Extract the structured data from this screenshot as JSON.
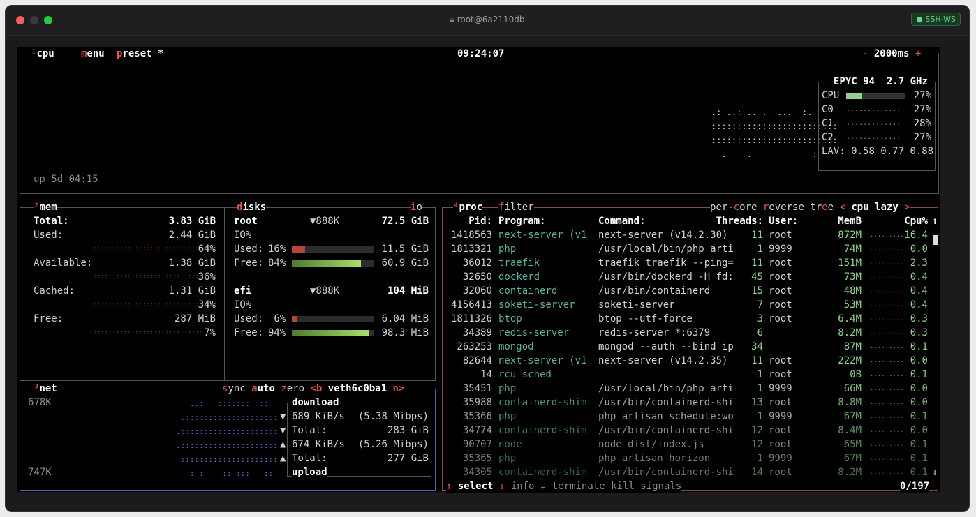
{
  "window": {
    "title": "root@6a2110db",
    "badge": "● SSH-WS"
  },
  "cpu": {
    "num": "¹",
    "label_cpu": "cpu",
    "label_menu": "menu",
    "label_preset": "preset *",
    "clock": "09:24:07",
    "interval": "2000ms",
    "minus": "-",
    "plus": "+",
    "uptime": "up 5d 04:15",
    "model": "EPYC 94",
    "freq": "2.7 GHz",
    "rows": [
      {
        "name": "CPU",
        "pct": "27%",
        "level": 0.27
      },
      {
        "name": "C0",
        "pct": "27%",
        "level": 0.27
      },
      {
        "name": "C1",
        "pct": "28%",
        "level": 0.28
      },
      {
        "name": "C2",
        "pct": "27%",
        "level": 0.27
      }
    ],
    "lav_label": "LAV:",
    "lav": "0.58 0.77 0.88"
  },
  "mem": {
    "num": "²",
    "title": "mem",
    "total_label": "Total:",
    "total": "3.83 GiB",
    "rows": [
      {
        "label": "Used:",
        "value": "2.44 GiB",
        "pct": "64%",
        "color": "#c0392b"
      },
      {
        "label": "Available:",
        "value": "1.38 GiB",
        "pct": "36%",
        "color": "#b8860b"
      },
      {
        "label": "Cached:",
        "value": "1.31 GiB",
        "pct": "34%",
        "color": "#4a6fb3"
      },
      {
        "label": "Free:",
        "value": "287 MiB",
        "pct": "7%",
        "color": "#7a5a2e"
      }
    ]
  },
  "disks": {
    "title_d": "d",
    "title_rest": "isks",
    "io_i": "i",
    "io_o": "o",
    "items": [
      {
        "name": "root",
        "io": "▼888K",
        "size": "72.5 GiB",
        "io_label": "IO%",
        "used_label": "Used:",
        "used_pct": "16%",
        "used": "11.5 GiB",
        "free_label": "Free:",
        "free_pct": "84%",
        "free": "60.9 GiB",
        "used_level": 0.16,
        "free_level": 0.84
      },
      {
        "name": "efi",
        "io": "▼888K",
        "size": "104 MiB",
        "io_label": "IO%",
        "used_label": "Used:",
        "used_pct": " 6%",
        "used": "6.04 MiB",
        "free_label": "Free:",
        "free_pct": "94%",
        "free": "98.3 MiB",
        "used_level": 0.06,
        "free_level": 0.94
      }
    ]
  },
  "net": {
    "num": "³",
    "title": "net",
    "sync": "sync",
    "auto": "auto",
    "zero": "zero",
    "iface_prev": "<b",
    "iface": "veth6c0ba1",
    "iface_next": "n>",
    "scale_top": "678K",
    "scale_bottom": "747K",
    "download": "download",
    "upload": "upload",
    "rows": [
      {
        "arrow": "▼",
        "label": "689 KiB/s",
        "value": "(5.38 Mibps)"
      },
      {
        "arrow": "▼",
        "label": "Total:",
        "value": "283 GiB"
      },
      {
        "arrow": "▲",
        "label": "674 KiB/s",
        "value": "(5.26 Mibps)"
      },
      {
        "arrow": "▲",
        "label": "Total:",
        "value": "277 GiB"
      }
    ]
  },
  "proc": {
    "num": "⁴",
    "title": "proc",
    "filter": "filter",
    "per_core": "per-core",
    "reverse": "reverse",
    "tree": "tree",
    "sort_prev": "<",
    "sort": "cpu lazy",
    "sort_next": ">",
    "headers": {
      "pid": "Pid:",
      "program": "Program:",
      "command": "Command:",
      "threads": "Threads:",
      "user": "User:",
      "memb": "MemB",
      "cpu": "Cpu%",
      "arrow": "↑"
    },
    "rows": [
      {
        "pid": "1418563",
        "program": "next-server (v1",
        "command": "next-server (v14.2.30)",
        "threads": "11",
        "user": "root",
        "mem": "872M",
        "cpu": "16.4"
      },
      {
        "pid": "1813321",
        "program": "php",
        "command": "/usr/local/bin/php arti",
        "threads": "1",
        "user": "9999",
        "mem": "74M",
        "cpu": "0.0"
      },
      {
        "pid": "36012",
        "program": "traefik",
        "command": "traefik traefik --ping=",
        "threads": "11",
        "user": "root",
        "mem": "151M",
        "cpu": "2.3"
      },
      {
        "pid": "32650",
        "program": "dockerd",
        "command": "/usr/bin/dockerd -H fd:",
        "threads": "45",
        "user": "root",
        "mem": "73M",
        "cpu": "0.4"
      },
      {
        "pid": "32060",
        "program": "containerd",
        "command": "/usr/bin/containerd",
        "threads": "15",
        "user": "root",
        "mem": "48M",
        "cpu": "0.4"
      },
      {
        "pid": "4156413",
        "program": "soketi-server",
        "command": "soketi-server",
        "threads": "7",
        "user": "root",
        "mem": "53M",
        "cpu": "0.4"
      },
      {
        "pid": "1811326",
        "program": "btop",
        "command": "btop --utf-force",
        "threads": "3",
        "user": "root",
        "mem": "6.4M",
        "cpu": "0.3"
      },
      {
        "pid": "34389",
        "program": "redis-server",
        "command": "redis-server *:6379",
        "threads": "6",
        "user": "",
        "mem": "8.2M",
        "cpu": "0.3"
      },
      {
        "pid": "263253",
        "program": "mongod",
        "command": "mongod --auth --bind_ip",
        "threads": "34",
        "user": "",
        "mem": "87M",
        "cpu": "0.1"
      },
      {
        "pid": "82644",
        "program": "next-server (v1",
        "command": "next-server (v14.2.35)",
        "threads": "11",
        "user": "root",
        "mem": "222M",
        "cpu": "0.0"
      },
      {
        "pid": "14",
        "program": "rcu_sched",
        "command": "",
        "threads": "1",
        "user": "root",
        "mem": "0B",
        "cpu": "0.1"
      },
      {
        "pid": "35451",
        "program": "php",
        "command": "/usr/local/bin/php arti",
        "threads": "1",
        "user": "9999",
        "mem": "66M",
        "cpu": "0.0"
      },
      {
        "pid": "35988",
        "program": "containerd-shim",
        "command": "/usr/bin/containerd-shi",
        "threads": "13",
        "user": "root",
        "mem": "8.8M",
        "cpu": "0.0"
      },
      {
        "pid": "35366",
        "program": "php",
        "command": "php artisan schedule:wo",
        "threads": "1",
        "user": "9999",
        "mem": "67M",
        "cpu": "0.1"
      },
      {
        "pid": "34774",
        "program": "containerd-shim",
        "command": "/usr/bin/containerd-shi",
        "threads": "12",
        "user": "root",
        "mem": "8.4M",
        "cpu": "0.0"
      },
      {
        "pid": "90707",
        "program": "node",
        "command": "node dist/index.js",
        "threads": "12",
        "user": "root",
        "mem": "65M",
        "cpu": "0.1"
      },
      {
        "pid": "35365",
        "program": "php",
        "command": "php artisan horizon",
        "threads": "1",
        "user": "9999",
        "mem": "67M",
        "cpu": "0.1"
      },
      {
        "pid": "34305",
        "program": "containerd-shim",
        "command": "/usr/bin/containerd-shi",
        "threads": "14",
        "user": "root",
        "mem": "8.2M",
        "cpu": "0.1"
      }
    ],
    "scroll_down": "↓",
    "footer": {
      "up": "↑",
      "select": "select",
      "down": "↓",
      "info": "info",
      "enter": "↲",
      "terminate": "terminate",
      "kill": "kill",
      "signals": "signals",
      "count": "0/197"
    }
  }
}
